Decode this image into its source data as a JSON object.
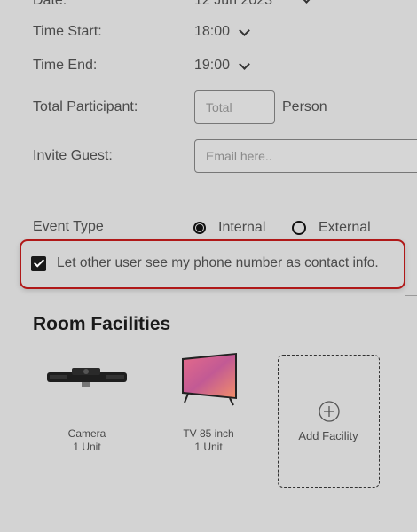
{
  "form": {
    "date_label": "Date:",
    "date_value": "12 Jun 2023",
    "time_start_label": "Time Start:",
    "time_start_value": "18:00",
    "time_end_label": "Time End:",
    "time_end_value": "19:00",
    "participant_label": "Total Participant:",
    "participant_placeholder": "Total",
    "participant_unit": "Person",
    "invite_label": "Invite Guest:",
    "invite_placeholder": "Email here..",
    "event_type_label": "Event Type",
    "event_type_options": [
      "Internal",
      "External"
    ],
    "event_type_selected": "Internal",
    "phone_checkbox_label": "Let other user see my phone number as contact info.",
    "phone_checkbox_checked": true
  },
  "facilities": {
    "title": "Room Facilities",
    "items": [
      {
        "name": "Camera",
        "qty": "1 Unit",
        "icon": "camera-soundbar-icon"
      },
      {
        "name": "TV 85 inch",
        "qty": "1 Unit",
        "icon": "tv-icon"
      }
    ],
    "add_label": "Add Facility"
  },
  "colors": {
    "background": "#d3d3d3",
    "highlight_border": "#b01818",
    "text": "#4a4a4a"
  }
}
